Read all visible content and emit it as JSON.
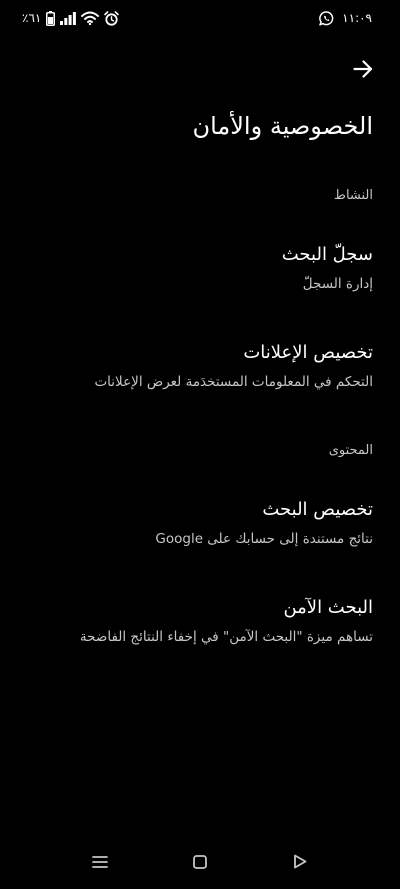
{
  "status_bar": {
    "time": "١١:٠٩",
    "battery_percent": "٪٦١",
    "icons": [
      "whatsapp-icon",
      "alarm-icon",
      "wifi-icon",
      "signal-icon",
      "battery-icon"
    ]
  },
  "header": {
    "title": "الخصوصية والأمان",
    "back_icon": "arrow-back-icon"
  },
  "sections": {
    "activity": {
      "label": "النشاط",
      "items": [
        {
          "title": "سجلّ البحث",
          "subtitle": "إدارة السجلّ"
        },
        {
          "title": "تخصيص الإعلانات",
          "subtitle": "التحكم في المعلومات المستخدَمة لعرض الإعلانات"
        }
      ]
    },
    "content": {
      "label": "المحتوى",
      "items": [
        {
          "title": "تخصيص البحث",
          "subtitle": "نتائج مستندة إلى حسابك على Google"
        },
        {
          "title": "البحث الآمن",
          "subtitle": "تساهم ميزة \"البحث الآمن\" في إخفاء النتائج الفاضحة"
        }
      ]
    }
  },
  "nav_bar": {
    "icons": [
      "menu-icon",
      "home-icon",
      "back-triangle-icon"
    ]
  },
  "colors": {
    "background": "#000000",
    "primary_text": "#ffffff",
    "secondary_text": "#c4c7c5"
  }
}
